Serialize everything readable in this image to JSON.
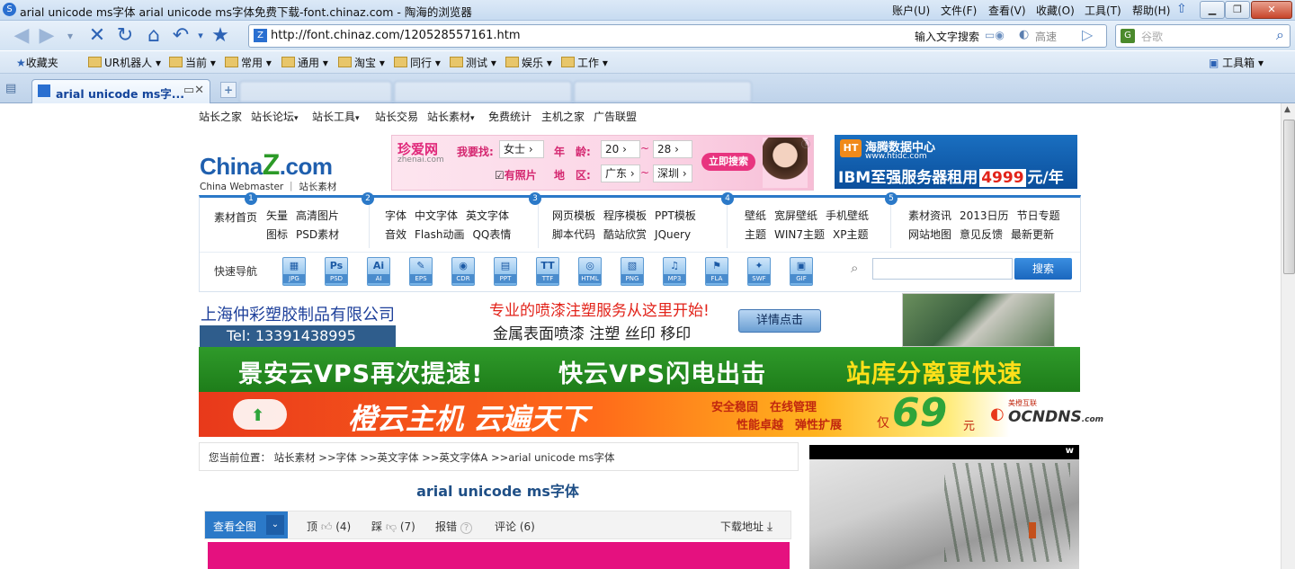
{
  "window": {
    "title": "arial unicode ms字体 arial unicode ms字体免费下载-font.chinaz.com - 陶海的浏览器",
    "menus": [
      "账户(U)",
      "文件(F)",
      "查看(V)",
      "收藏(O)",
      "工具(T)",
      "帮助(H)"
    ]
  },
  "address": {
    "url": "http://font.chinaz.com/120528557161.htm",
    "search_keyword_label": "输入文字搜索",
    "fast_label": "高速"
  },
  "search": {
    "placeholder": "谷歌"
  },
  "bookmarks": {
    "favorites": "收藏夹",
    "folders": [
      "UR机器人",
      "当前",
      "常用",
      "通用",
      "淘宝",
      "同行",
      "测试",
      "娱乐",
      "工作"
    ],
    "toolbox": "工具箱"
  },
  "tabs": {
    "active_title": "arial unicode ms字..."
  },
  "site": {
    "topnav": [
      "站长之家",
      "站长论坛",
      "站长工具",
      "站长交易",
      "站长素材",
      "免费统计",
      "主机之家",
      "广告联盟"
    ],
    "logo": {
      "china": "China",
      "z": "Z",
      "com": ".com",
      "sub": "China Webmaster ｜ 站长素材"
    },
    "zhenai": {
      "brand": "珍爱网",
      "domain": "zhenai.com",
      "find": "我要找:",
      "gender": "女士",
      "age_label": "年　龄:",
      "age_from": "20",
      "age_to": "28",
      "photo": "有照片",
      "region_label": "地　区:",
      "province": "广东",
      "city": "深圳",
      "btn": "立即搜索"
    },
    "htidc": {
      "name": "海腾数据中心",
      "domain": "www.htidc.com",
      "slogan": "IBM至强服务器租用",
      "price": "4999",
      "unit": "元/年"
    },
    "categories": [
      {
        "num": "1",
        "items": [
          "素材首页"
        ]
      },
      {
        "num": "1",
        "items": [
          "矢量",
          "高清图片",
          "图标",
          "PSD素材"
        ]
      },
      {
        "num": "2",
        "items": [
          "字体",
          "中文字体",
          "英文字体",
          "音效",
          "Flash动画",
          "QQ表情"
        ]
      },
      {
        "num": "3",
        "items": [
          "网页模板",
          "程序模板",
          "PPT模板",
          "脚本代码",
          "酷站欣赏",
          "JQuery"
        ]
      },
      {
        "num": "4",
        "items": [
          "壁纸",
          "宽屏壁纸",
          "手机壁纸",
          "主题",
          "WIN7主题",
          "XP主题"
        ]
      },
      {
        "num": "5",
        "items": [
          "素材资讯",
          "2013日历",
          "节日专题",
          "网站地图",
          "意见反馈",
          "最新更新"
        ]
      }
    ],
    "quicknav_label": "快速导航",
    "filetypes": [
      {
        "glyph": "▦",
        "label": "JPG"
      },
      {
        "glyph": "Ps",
        "label": "PSD"
      },
      {
        "glyph": "Ai",
        "label": "AI"
      },
      {
        "glyph": "✎",
        "label": "EPS"
      },
      {
        "glyph": "◉",
        "label": "CDR"
      },
      {
        "glyph": "▤",
        "label": "PPT"
      },
      {
        "glyph": "TT",
        "label": "TTF"
      },
      {
        "glyph": "◎",
        "label": "HTML"
      },
      {
        "glyph": "▧",
        "label": "PNG"
      },
      {
        "glyph": "♫",
        "label": "MP3"
      },
      {
        "glyph": "⚑",
        "label": "FLA"
      },
      {
        "glyph": "✦",
        "label": "SWF"
      },
      {
        "glyph": "▣",
        "label": "GIF"
      }
    ],
    "search_btn": "搜索",
    "plastic_ad": {
      "company": "上海仲彩塑胶制品有限公司",
      "tel": "Tel: 13391438995",
      "headline": "专业的喷漆注塑服务从这里开始!",
      "services": "金属表面喷漆 注塑 丝印 移印",
      "btn": "详情点击"
    },
    "vps_ad": {
      "left": "景安云VPS再次提速!",
      "mid": "快云VPS闪电出击",
      "right": "站库分离更快速"
    },
    "orange_ad": {
      "title": "橙云主机 云遍天下",
      "f1": "安全稳固",
      "f2": "在线管理",
      "f3": "性能卓越",
      "f4": "弹性扩展",
      "prefix": "仅",
      "price": "69",
      "unit": "元",
      "brand": "OCNDNS",
      "brand_tail": ".com",
      "brand_cn": "美橙互联"
    },
    "breadcrumb": "您当前位置：  站长素材  >>字体 >>英文字体 >>英文字体A >>arial unicode ms字体",
    "article_title": "arial unicode ms字体",
    "actions": {
      "view_all": "查看全图",
      "up": "顶",
      "up_count": "(4)",
      "down": "踩",
      "down_count": "(7)",
      "report": "报错",
      "comment": "评论",
      "comment_count": "(6)",
      "download": "下载地址"
    },
    "video_logo": "w"
  },
  "colors": {
    "accent": "#2b79c8",
    "magenta": "#e5117f",
    "green_ad": "#2f9a2a"
  }
}
